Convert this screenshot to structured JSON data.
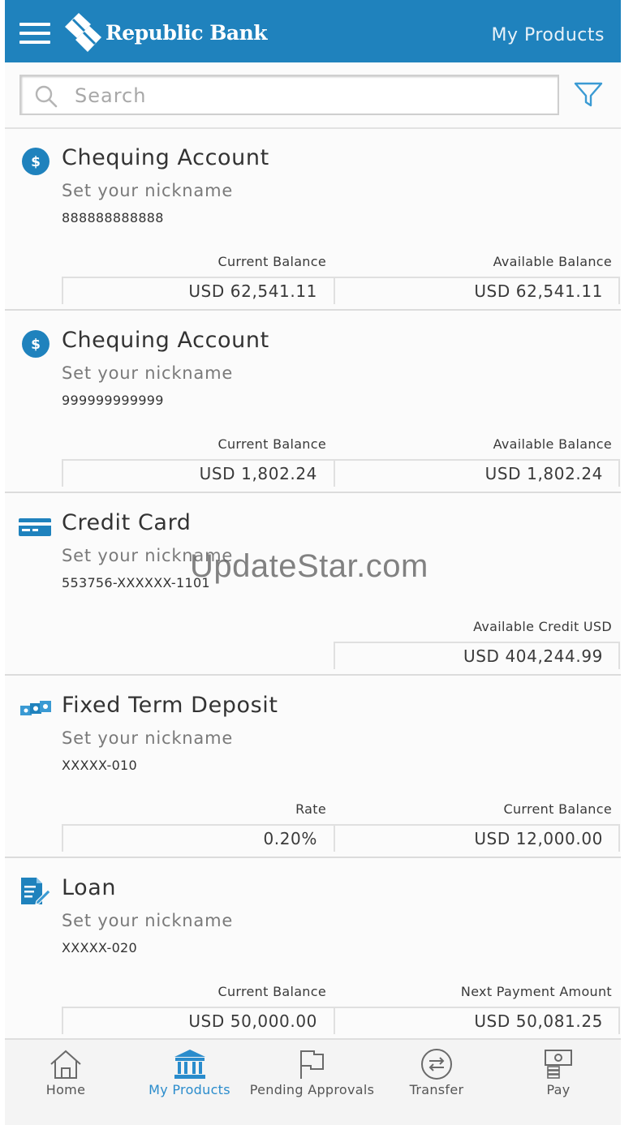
{
  "header": {
    "brand": "Republic Bank",
    "title": "My Products"
  },
  "search": {
    "placeholder": "Search"
  },
  "products": [
    {
      "type": "Chequing Account",
      "icon": "dollar-circle-icon",
      "nickname": "Set your nickname",
      "account_number": "888888888888",
      "left_label": "Current Balance",
      "left_value": "USD 62,541.11",
      "right_label": "Available Balance",
      "right_value": "USD 62,541.11"
    },
    {
      "type": "Chequing Account",
      "icon": "dollar-circle-icon",
      "nickname": "Set your nickname",
      "account_number": "999999999999",
      "left_label": "Current Balance",
      "left_value": "USD 1,802.24",
      "right_label": "Available Balance",
      "right_value": "USD 1,802.24"
    },
    {
      "type": "Credit Card",
      "icon": "credit-card-icon",
      "nickname": "Set your nickname",
      "account_number": "553756-XXXXXX-1101",
      "right_label": "Available Credit USD",
      "right_value": "USD 404,244.99"
    },
    {
      "type": "Fixed Term Deposit",
      "icon": "money-stack-icon",
      "nickname": "Set your nickname",
      "account_number": "XXXXX-010",
      "left_label": "Rate",
      "left_value": "0.20%",
      "right_label": "Current Balance",
      "right_value": "USD 12,000.00"
    },
    {
      "type": "Loan",
      "icon": "loan-document-icon",
      "nickname": "Set your nickname",
      "account_number": "XXXXX-020",
      "left_label": "Current Balance",
      "left_value": "USD 50,000.00",
      "right_label": "Next Payment Amount",
      "right_value": "USD 50,081.25"
    }
  ],
  "watermark": "UpdateStar.com",
  "bottom_nav": [
    {
      "label": "Home",
      "icon": "home-icon",
      "active": false
    },
    {
      "label": "My Products",
      "icon": "bank-icon",
      "active": true
    },
    {
      "label": "Pending Approvals",
      "icon": "flag-icon",
      "active": false
    },
    {
      "label": "Transfer",
      "icon": "transfer-icon",
      "active": false
    },
    {
      "label": "Pay",
      "icon": "pay-icon",
      "active": false
    }
  ],
  "colors": {
    "brand_blue": "#1f82bd",
    "accent_blue": "#2a8ccc",
    "text": "#333333"
  }
}
